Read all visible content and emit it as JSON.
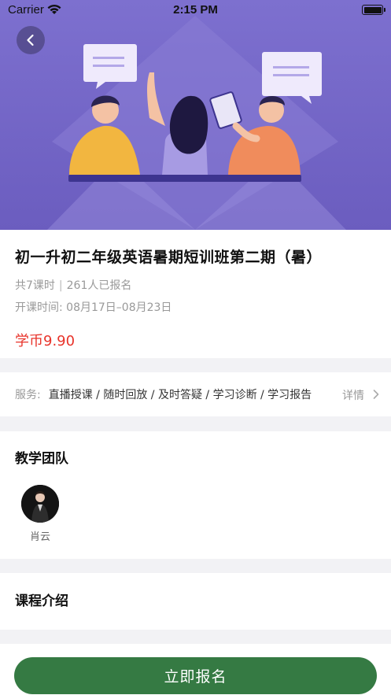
{
  "status_bar": {
    "carrier": "Carrier",
    "time": "2:15 PM"
  },
  "course": {
    "title": "初一升初二年级英语暑期短训班第二期（暑）",
    "lessons": "共7课时",
    "enrolled": "261人已报名",
    "schedule": "开课时间: 08月17日–08月23日",
    "price": "学币9.90"
  },
  "services": {
    "label": "服务:",
    "items": "直播授课 / 随时回放 / 及时答疑 / 学习诊断 / 学习报告",
    "detail_label": "详情"
  },
  "team": {
    "heading": "教学团队",
    "teachers": [
      {
        "name": "肖云"
      }
    ]
  },
  "intro": {
    "heading": "课程介绍"
  },
  "actions": {
    "enroll_label": "立即报名"
  },
  "colors": {
    "accent": "#357a43",
    "price": "#e8332a",
    "hero": "#7668c7"
  },
  "icons": {
    "back": "chevron-left-icon",
    "detail": "chevron-right-icon",
    "wifi": "wifi-icon",
    "battery": "battery-icon"
  }
}
